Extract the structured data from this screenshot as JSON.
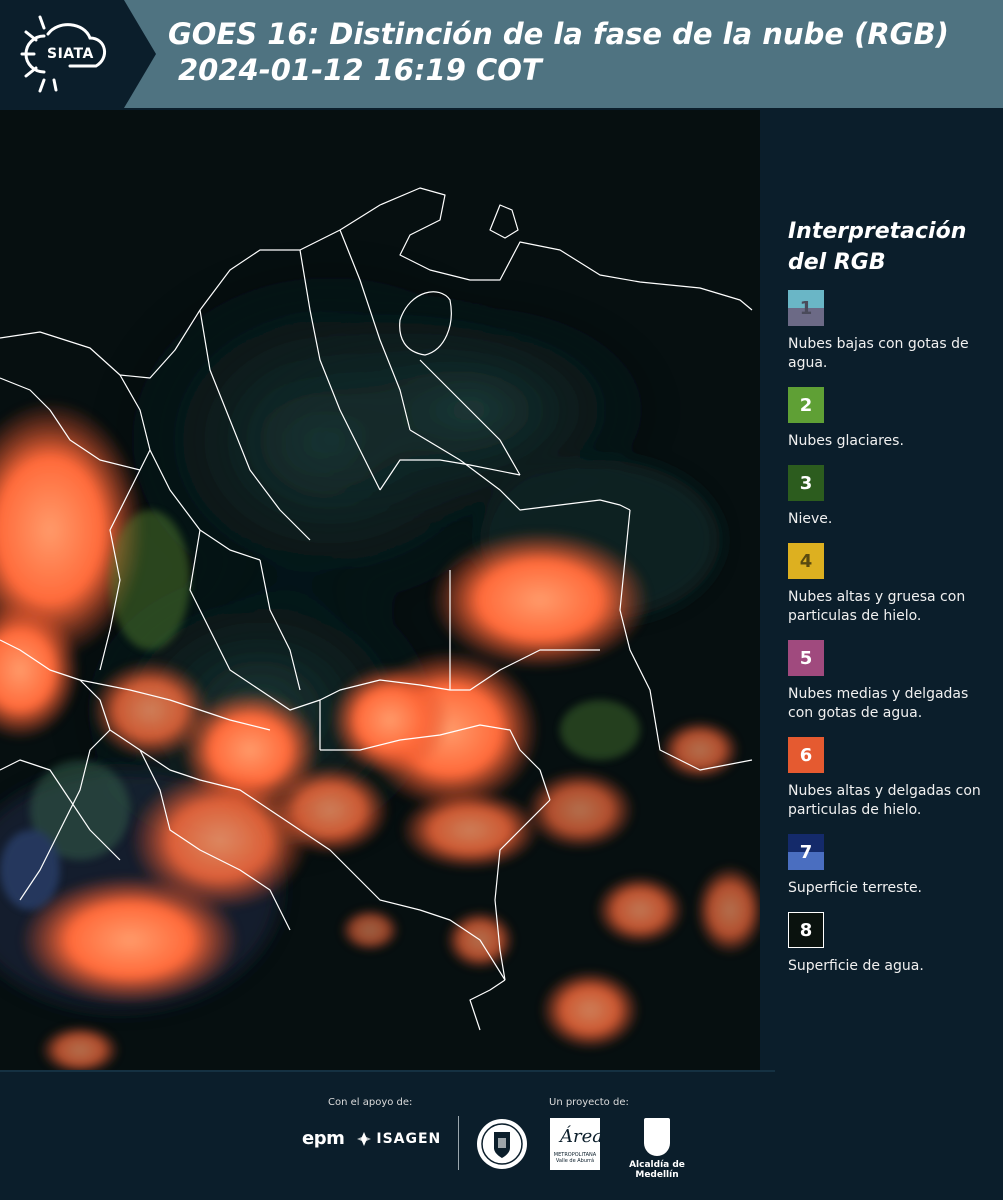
{
  "header": {
    "logo_text": "SIATA",
    "title_line1": "GOES 16: Distinción de la fase de la nube (RGB)",
    "title_line2": "2024-01-12 16:19 COT"
  },
  "legend": {
    "title_line1": "Interpretación",
    "title_line2": "del RGB",
    "items": [
      {
        "number": "1",
        "label": "Nubes bajas con gotas de agua.",
        "color_top": "#6ab6c6",
        "color_bottom": "#6c6a86"
      },
      {
        "number": "2",
        "label": "Nubes glaciares.",
        "color": "#5fa035"
      },
      {
        "number": "3",
        "label": "Nieve.",
        "color": "#2c5c1e"
      },
      {
        "number": "4",
        "label": "Nubes altas y gruesa con particulas de hielo.",
        "color": "#ddb020"
      },
      {
        "number": "5",
        "label": "Nubes medias y delgadas con gotas de agua.",
        "color": "#a04a7e"
      },
      {
        "number": "6",
        "label": "Nubes altas y delgadas con particulas de hielo.",
        "color": "#e55a30"
      },
      {
        "number": "7",
        "label": "Superficie terreste.",
        "color_top": "#142a6a",
        "color_bottom": "#4a6ec0"
      },
      {
        "number": "8",
        "label": "Superficie de agua.",
        "color": "#0a120e"
      }
    ]
  },
  "footer": {
    "support_label": "Con el apoyo de:",
    "project_label": "Un proyecto de:",
    "sponsor1": "epm",
    "sponsor2": "ISAGEN",
    "area_logo_text": "Área",
    "area_logo_sub": "METROPOLITANA Valle de Aburrá",
    "partner": "Alcaldía de Medellín"
  },
  "colors": {
    "background": "#0b1e2b",
    "header_band": "#4f7381",
    "cloud_orange": "#ff6a3a"
  }
}
